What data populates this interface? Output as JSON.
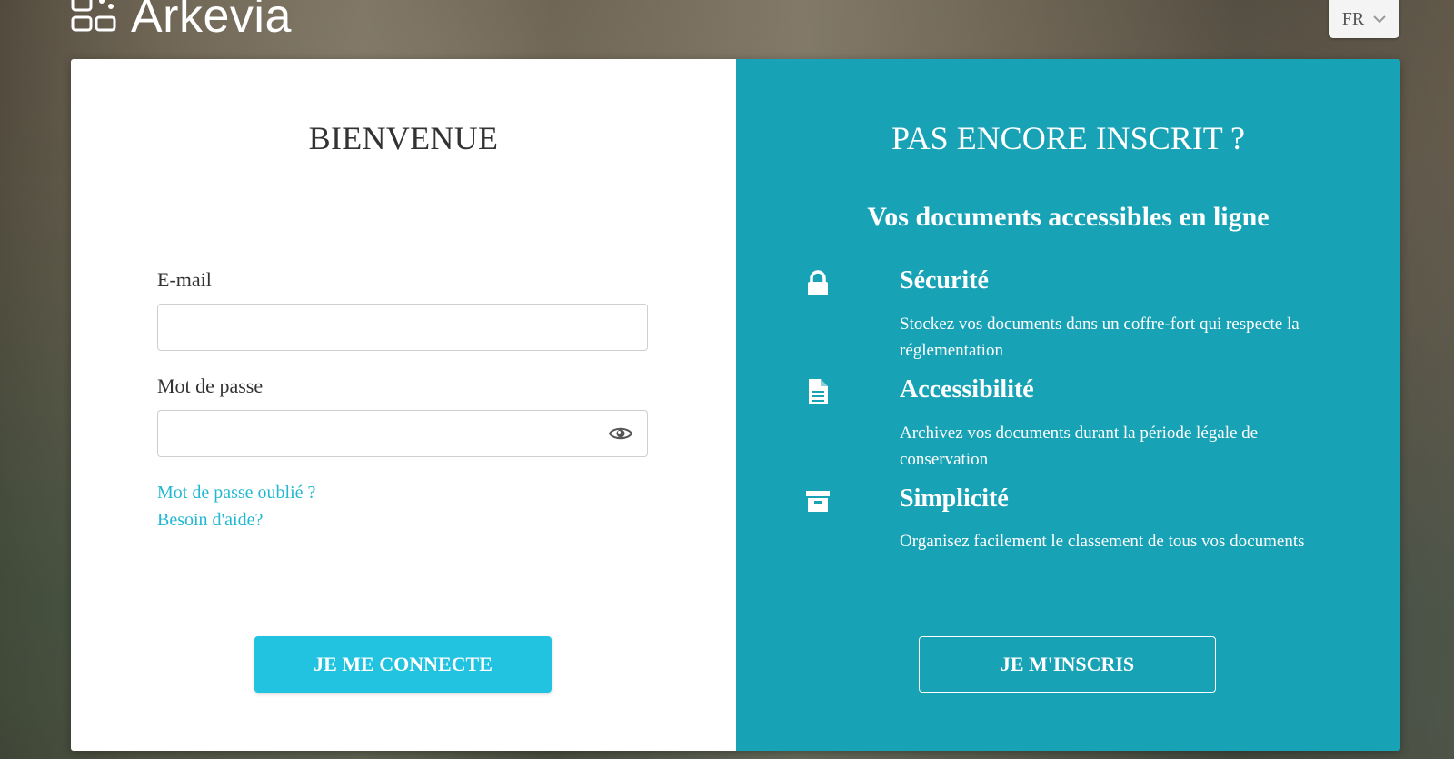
{
  "header": {
    "logo_text": "Arkevia",
    "language": "FR"
  },
  "login": {
    "title": "BIENVENUE",
    "email_label": "E-mail",
    "email_value": "",
    "password_label": "Mot de passe",
    "password_value": "",
    "forgot_password": "Mot de passe oublié ?",
    "help": "Besoin d'aide?",
    "submit": "JE ME CONNECTE"
  },
  "signup": {
    "title": "PAS ENCORE INSCRIT ?",
    "subtitle": "Vos documents accessibles en ligne",
    "features": [
      {
        "icon": "lock-icon",
        "title": "Sécurité",
        "desc": "Stockez vos documents dans un coffre-fort qui respecte la réglementation"
      },
      {
        "icon": "document-icon",
        "title": "Accessibilité",
        "desc": "Archivez vos documents durant la période légale de conservation"
      },
      {
        "icon": "archive-box-icon",
        "title": "Simplicité",
        "desc": "Organisez facilement le classement de tous vos documents"
      }
    ],
    "submit": "JE M'INSCRIS"
  },
  "colors": {
    "accent": "#22c3e0",
    "panel": "#18a2b6"
  }
}
